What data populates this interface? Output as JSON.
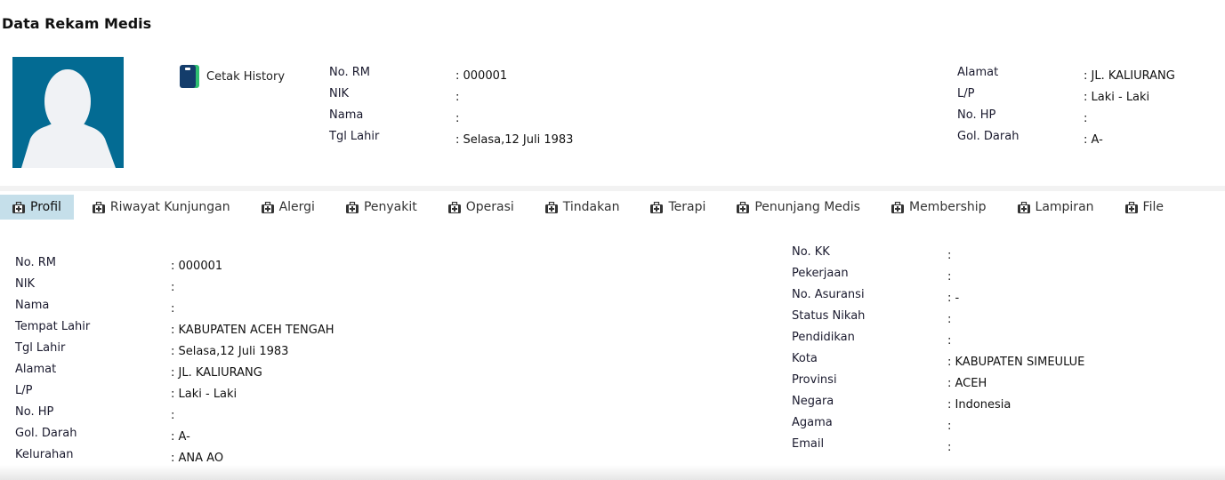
{
  "page_title": "Data Rekam Medis",
  "cetak_history": "Cetak History",
  "header": {
    "left": [
      {
        "label": "No. RM",
        "value": ": 000001"
      },
      {
        "label": "NIK",
        "value": ":"
      },
      {
        "label": "Nama",
        "value": ":"
      },
      {
        "label": "Tgl Lahir",
        "value": ": Selasa,12 Juli 1983"
      }
    ],
    "right": [
      {
        "label": "Alamat",
        "value": ": JL. KALIURANG"
      },
      {
        "label": "L/P",
        "value": ": Laki - Laki"
      },
      {
        "label": "No. HP",
        "value": ":"
      },
      {
        "label": "Gol. Darah",
        "value": ": A-"
      }
    ]
  },
  "tabs": [
    {
      "label": "Profil",
      "active": true
    },
    {
      "label": "Riwayat Kunjungan"
    },
    {
      "label": "Alergi"
    },
    {
      "label": "Penyakit"
    },
    {
      "label": "Operasi"
    },
    {
      "label": "Tindakan"
    },
    {
      "label": "Terapi"
    },
    {
      "label": "Penunjang Medis"
    },
    {
      "label": "Membership"
    },
    {
      "label": "Lampiran"
    },
    {
      "label": "File"
    }
  ],
  "profil": {
    "left": [
      {
        "label": "No. RM",
        "value": ": 000001"
      },
      {
        "label": "NIK",
        "value": ":"
      },
      {
        "label": "Nama",
        "value": ":"
      },
      {
        "label": "Tempat Lahir",
        "value": ": KABUPATEN ACEH TENGAH"
      },
      {
        "label": "Tgl Lahir",
        "value": ": Selasa,12 Juli 1983"
      },
      {
        "label": "Alamat",
        "value": ": JL. KALIURANG"
      },
      {
        "label": "L/P",
        "value": ": Laki - Laki"
      },
      {
        "label": "No. HP",
        "value": ":"
      },
      {
        "label": "Gol. Darah",
        "value": ": A-"
      },
      {
        "label": "Kelurahan",
        "value": ": ANA AO"
      }
    ],
    "right": [
      {
        "label": "No. KK",
        "value": ":"
      },
      {
        "label": "Pekerjaan",
        "value": ":"
      },
      {
        "label": "No. Asuransi",
        "value": ": -"
      },
      {
        "label": "Status Nikah",
        "value": ":"
      },
      {
        "label": "Pendidikan",
        "value": ":"
      },
      {
        "label": "Kota",
        "value": ": KABUPATEN SIMEULUE"
      },
      {
        "label": "Provinsi",
        "value": ": ACEH"
      },
      {
        "label": "Negara",
        "value": ": Indonesia"
      },
      {
        "label": "Agama",
        "value": ":"
      },
      {
        "label": "Email",
        "value": ":"
      }
    ]
  },
  "colors": {
    "avatar_bg": "#036b93",
    "active_tab": "#c5dfea",
    "icon_navy": "#143d6b",
    "icon_green": "#2fbf71"
  },
  "icons": {
    "cetak": "print-book-icon",
    "tab": "medical-kit-icon"
  }
}
